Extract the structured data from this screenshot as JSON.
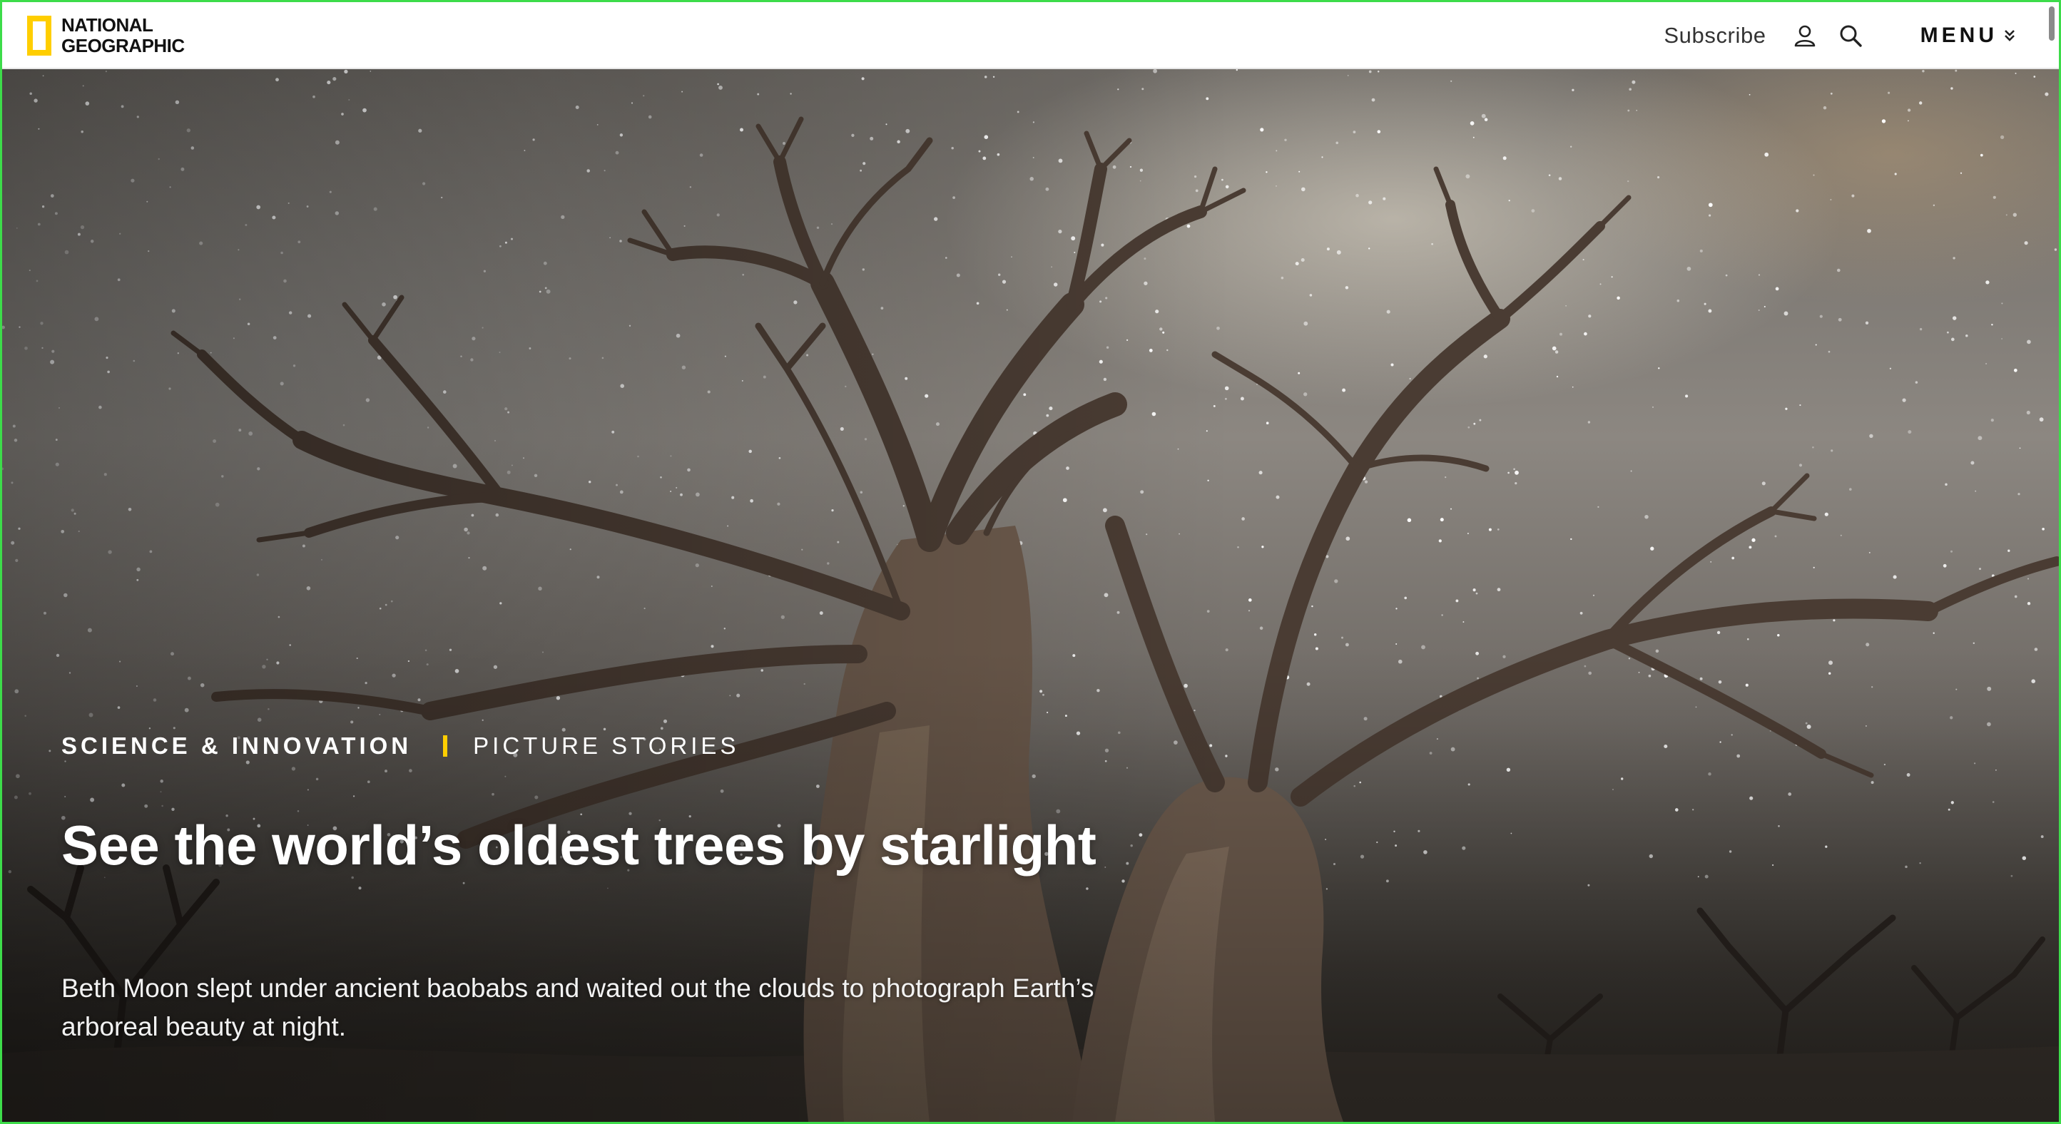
{
  "header": {
    "logo_line1": "NATIONAL",
    "logo_line2": "GEOGRAPHIC",
    "subscribe_label": "Subscribe",
    "account_icon": "user-icon",
    "search_icon": "search-icon",
    "menu_label": "MENU",
    "menu_icon": "chevron-down-icon",
    "brand_color": "#ffce00"
  },
  "hero": {
    "kicker_primary": "SCIENCE & INNOVATION",
    "kicker_secondary": "PICTURE STORIES",
    "headline": "See the world’s oldest trees by starlight",
    "dek": "Beth Moon slept under ancient baobabs and waited out the clouds to photograph Earth’s arboreal beauty at night."
  }
}
